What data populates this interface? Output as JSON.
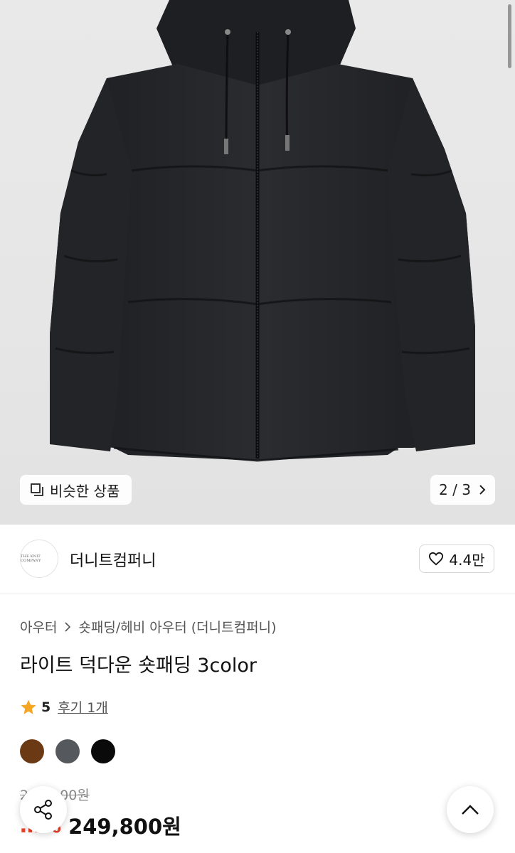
{
  "gallery": {
    "similar_label": "비슷한 상품",
    "page_indicator": "2 / 3",
    "image_alt": "black hooded puffer jacket"
  },
  "brand": {
    "logo_text": "THE KNIT COMPANY",
    "name": "더니트컴퍼니",
    "like_count": "4.4만"
  },
  "product": {
    "breadcrumb": [
      "아우터",
      "숏패딩/헤비 아우터 (더니트컴퍼니)"
    ],
    "title": "라이트 덕다운 숏패딩 3color",
    "rating": "5",
    "reviews": "후기 1개",
    "colors": [
      "#6b3a15",
      "#55595e",
      "#0a0a0a"
    ],
    "original_price": "2…,…00원",
    "discount": "…%",
    "sale_price": "249,800원"
  },
  "icons": {
    "similar": "similar-products-icon",
    "chevron": "chevron-right-icon",
    "heart": "heart-icon",
    "star": "star-icon",
    "share": "share-icon",
    "top": "chevron-up-icon"
  }
}
